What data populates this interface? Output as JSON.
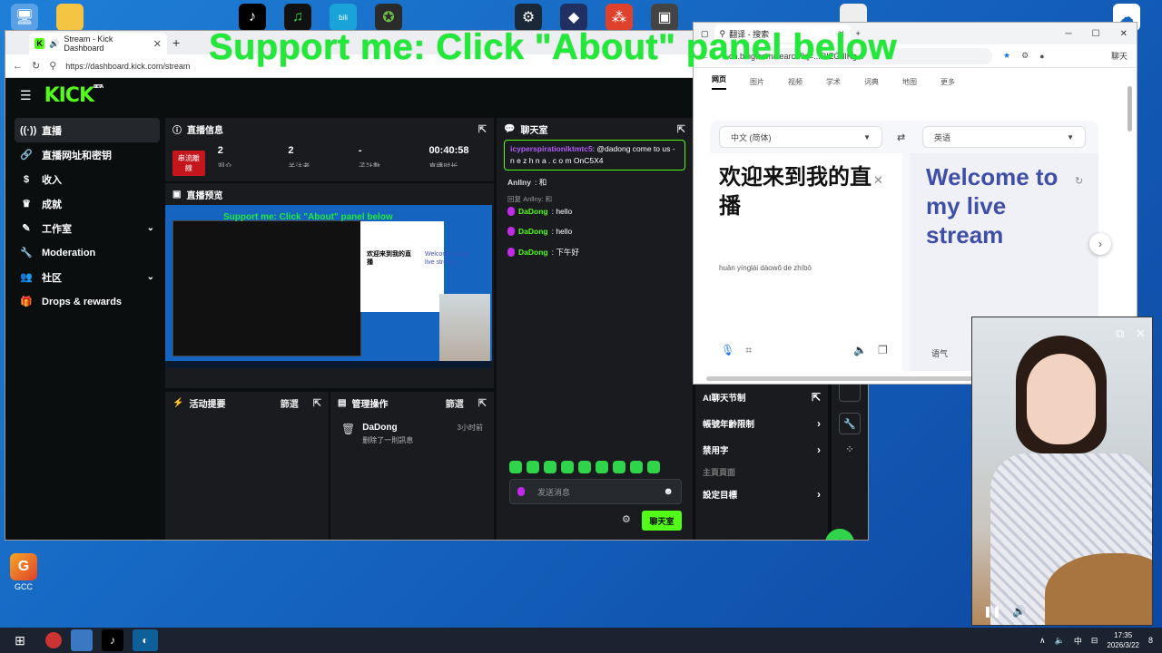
{
  "overlay_text": "Support me: Click \"About\" panel below",
  "kick_tab": {
    "title": "Stream - Kick Dashboard",
    "url": "https://dashboard.kick.com/stream"
  },
  "kick_logo": "KICK",
  "kick_logo_badge": "BETA",
  "sidebar": {
    "items": [
      {
        "label": "直播",
        "icon": "live-icon"
      },
      {
        "label": "直播网址和密钥",
        "icon": "link-icon"
      },
      {
        "label": "收入",
        "icon": "dollar-icon"
      },
      {
        "label": "成就",
        "icon": "trophy-icon"
      },
      {
        "label": "工作室",
        "icon": "pen-icon"
      },
      {
        "label": "Moderation",
        "icon": "wrench-icon"
      },
      {
        "label": "社区",
        "icon": "people-icon"
      },
      {
        "label": "Drops & rewards",
        "icon": "gift-icon"
      }
    ]
  },
  "stream_info": {
    "title": "直播信息",
    "badge": "串流離線",
    "stats": [
      {
        "value": "2",
        "label": "观众"
      },
      {
        "value": "2",
        "label": "关注者"
      },
      {
        "value": "-",
        "label": "子計數"
      },
      {
        "value": "00:40:58",
        "label": "直播时长"
      }
    ]
  },
  "preview": {
    "title": "直播预览",
    "overlay": "Support me: Click \"About\" panel below",
    "cn": "欢迎来到我的直播",
    "en": "Welcome to my live stream"
  },
  "activity": {
    "title": "活动提要",
    "filter": "篩選"
  },
  "mod_actions": {
    "title": "管理操作",
    "filter": "篩選",
    "entries": [
      {
        "name": "DaDong",
        "desc": "删除了一則訊息",
        "time": "3小时前"
      }
    ]
  },
  "chat": {
    "title": "聊天室",
    "pinned_user": "icyperspirationlktmtc5",
    "pinned_text": ": @dadong come to us - n e z h n a . c o m OnC5X4",
    "messages": [
      {
        "user": "Anllny",
        "text": ": 和",
        "reply": ""
      },
      {
        "user": "DaDong",
        "text": ": hello",
        "reply": "回复 Anllny: 和"
      },
      {
        "user": "DaDong",
        "text": ": hello",
        "reply": ""
      },
      {
        "user": "DaDong",
        "text": ": 下午好",
        "reply": ""
      }
    ],
    "input_placeholder": "发送消息",
    "send_label": "聊天室"
  },
  "right_menu": {
    "items": [
      {
        "label": "AI聊天节制",
        "arrow": "⇱"
      },
      {
        "label": "帳號年齡限制",
        "arrow": "›"
      },
      {
        "label": "禁用字",
        "arrow": "›"
      },
      {
        "label": "主頁頁面",
        "arrow": ""
      },
      {
        "label": "設定目標",
        "arrow": "›"
      }
    ]
  },
  "translate": {
    "tab_title": "翻译 - 搜索",
    "url": "cn.bing.com/search?q=...RIZGdIKg...",
    "chat_btn": "聊天",
    "nav": [
      "网页",
      "图片",
      "视频",
      "学术",
      "词典",
      "地图",
      "更多"
    ],
    "src_lang": "中文 (简体)",
    "tgt_lang": "英语",
    "src_text": "欢迎来到我的直播",
    "pinyin": "huān yínglái dàowǒ de zhíbō",
    "tgt_text": "Welcome to my live stream",
    "tone": "语气"
  },
  "taskbar": {
    "time": "17:35",
    "date": "2026/3/22",
    "ime": "中",
    "notif": "8"
  },
  "desktop": {
    "gcc_label": "GCC"
  }
}
